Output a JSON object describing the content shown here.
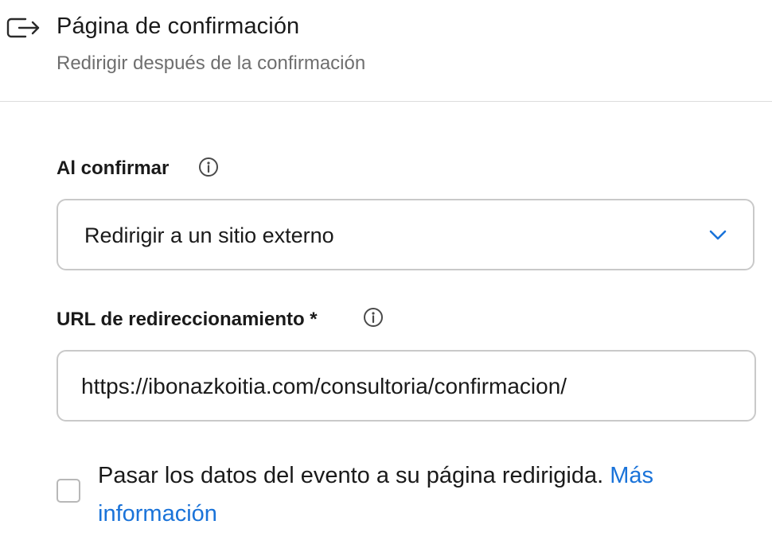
{
  "header": {
    "icon": "exit-arrow-icon",
    "title": "Página de confirmación",
    "subtitle": "Redirigir después de la confirmación"
  },
  "on_confirm": {
    "label": "Al confirmar",
    "info_icon": "info-icon",
    "selected_option": "Redirigir a un sitio externo",
    "dropdown_icon": "chevron-down-icon"
  },
  "redirect_url": {
    "label": "URL de redireccionamiento *",
    "info_icon": "info-icon",
    "value": "https://ibonazkoitia.com/consultoria/confirmacion/"
  },
  "pass_data": {
    "checked": false,
    "text": "Pasar los datos del evento a su página redirigida.",
    "link_text_1": "Más",
    "link_text_2": "información"
  },
  "colors": {
    "accent": "#1a73d9",
    "text": "#1a1a1a",
    "muted": "#6e6e6e",
    "border": "#c9c9c9"
  }
}
